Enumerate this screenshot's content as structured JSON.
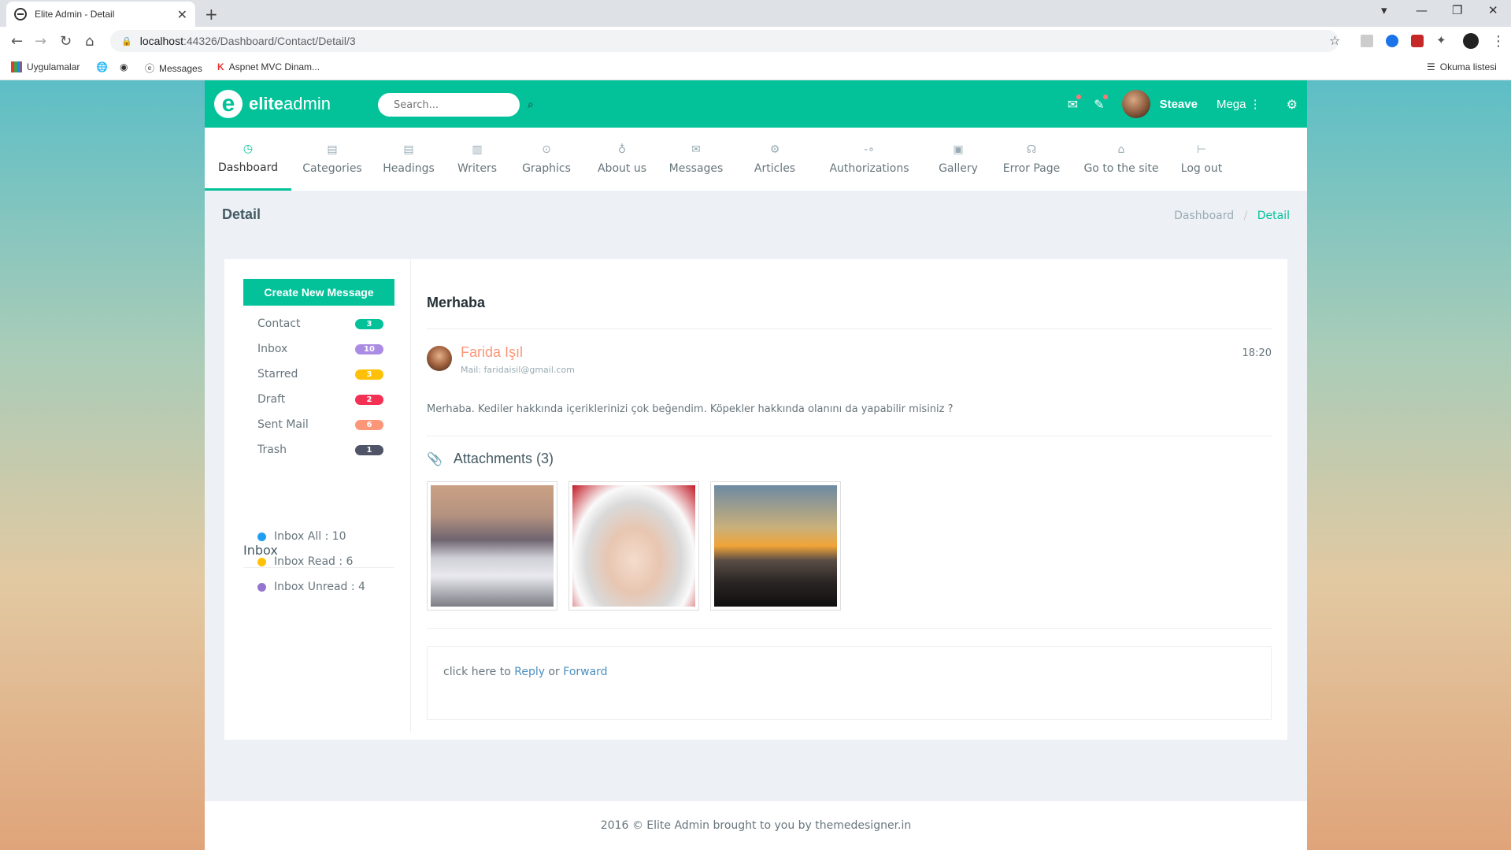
{
  "browser": {
    "tab_title": "Elite Admin - Detail",
    "url_host": "localhost",
    "url_rest": ":44326/Dashboard/Contact/Detail/3",
    "bookmarks": [
      "Uygulamalar",
      "Messages",
      "Aspnet MVC Dinam...",
      "Okuma listesi"
    ]
  },
  "app": {
    "brand_bold": "elite",
    "brand_light": "admin",
    "search_placeholder": "Search...",
    "user_name": "Steave",
    "mega_label": "Mega",
    "accent": "#03c29a"
  },
  "menu": [
    {
      "label": "Dashboard",
      "icon": "dashboard-icon"
    },
    {
      "label": "Categories",
      "icon": "categories-icon"
    },
    {
      "label": "Headings",
      "icon": "headings-icon"
    },
    {
      "label": "Writers",
      "icon": "writers-icon"
    },
    {
      "label": "Graphics",
      "icon": "location-pin-icon"
    },
    {
      "label": "About us",
      "icon": "lightbulb-icon"
    },
    {
      "label": "Messages",
      "icon": "mail-icon"
    },
    {
      "label": "Articles",
      "icon": "gear-icon"
    },
    {
      "label": "Authorizations",
      "icon": "key-icon"
    },
    {
      "label": "Gallery",
      "icon": "gallery-icon"
    },
    {
      "label": "Error Page",
      "icon": "headset-icon"
    },
    {
      "label": "Go to the site",
      "icon": "home-icon"
    },
    {
      "label": "Log out",
      "icon": "logout-icon"
    }
  ],
  "page": {
    "title": "Detail",
    "breadcrumb": [
      "Dashboard",
      "Detail"
    ]
  },
  "sidebar": {
    "create_label": "Create New Message",
    "folders": [
      {
        "label": "Contact",
        "count": "3",
        "color": "#03c29a"
      },
      {
        "label": "Inbox",
        "count": "10",
        "color": "#ab8ce4"
      },
      {
        "label": "Starred",
        "count": "3",
        "color": "#fec107"
      },
      {
        "label": "Draft",
        "count": "2",
        "color": "#f33155"
      },
      {
        "label": "Sent Mail",
        "count": "6",
        "color": "#fb9678"
      },
      {
        "label": "Trash",
        "count": "1",
        "color": "#4f5467"
      }
    ],
    "inbox_title": "Inbox",
    "stats": [
      {
        "label": "Inbox All : 10",
        "color": "#1e9ff2"
      },
      {
        "label": "Inbox Read : 6",
        "color": "#fec107"
      },
      {
        "label": "Inbox Unread : 4",
        "color": "#9675ce"
      }
    ]
  },
  "message": {
    "subject": "Merhaba",
    "sender": "Farida Işıl",
    "mail": "Mail: faridaisil@gmail.com",
    "time": "18:20",
    "body": "Merhaba. Kediler hakkında içeriklerinizi çok beğendim. Köpekler hakkında olanını da yapabilir misiniz ?",
    "attachments_title": "Attachments (3)",
    "reply_prefix": "click here to",
    "reply_label": "Reply",
    "or_label": "or",
    "forward_label": "Forward"
  },
  "footer": {
    "text": "2016 © Elite Admin brought to you by themedesigner.in"
  }
}
